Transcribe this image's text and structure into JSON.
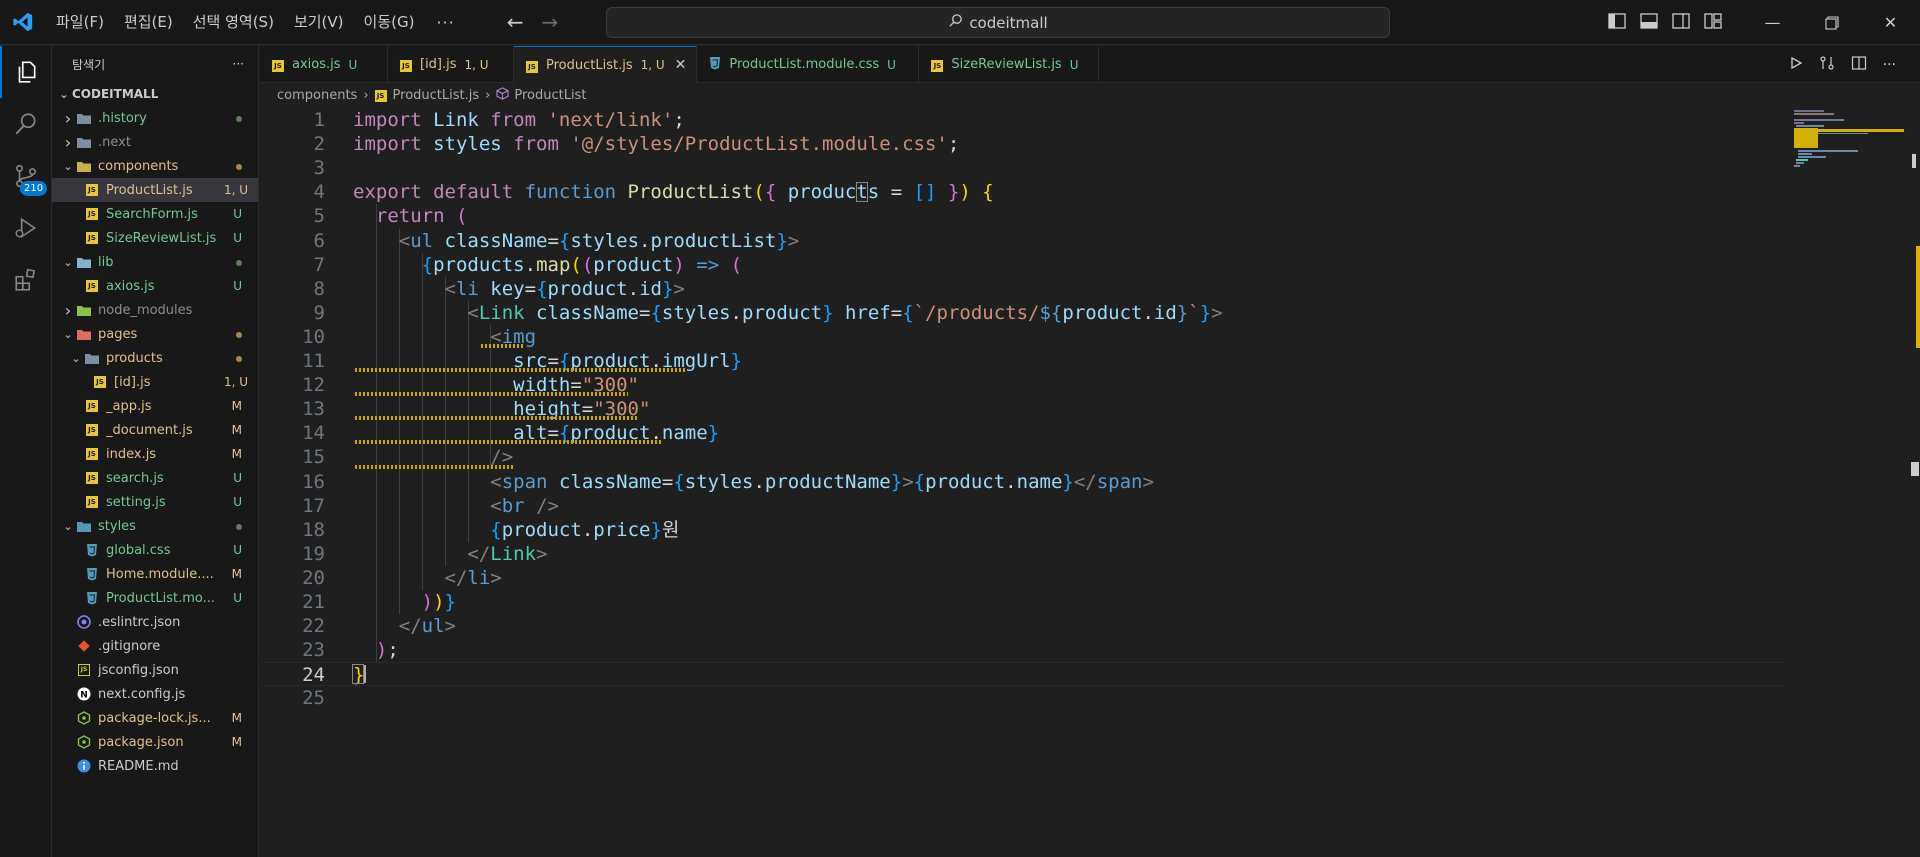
{
  "menu": [
    "파일(F)",
    "편집(E)",
    "선택 영역(S)",
    "보기(V)",
    "이동(G)"
  ],
  "menu_more": "···",
  "search": {
    "text": "codeitmall"
  },
  "activity": {
    "scm_badge": "210"
  },
  "explorer": {
    "title": "탐색기",
    "more": "···",
    "root": "CODEITMALL",
    "items": [
      {
        "name": ".history",
        "type": "folder",
        "depth": 0,
        "expanded": false,
        "status": "",
        "dot": "#5f7b59",
        "name_color": "#73c991",
        "icon_color": "#7f8fa3"
      },
      {
        "name": ".next",
        "type": "folder",
        "depth": 0,
        "expanded": false,
        "status": "",
        "dot": "",
        "name_color": "#8c8c8c",
        "icon_color": "#7f8fa3"
      },
      {
        "name": "components",
        "type": "folder",
        "depth": 0,
        "expanded": true,
        "status": "",
        "dot": "#a8884a",
        "name_color": "#e2c08d",
        "icon_color": "#c8b04a"
      },
      {
        "name": "ProductList.js",
        "type": "js",
        "depth": 1,
        "status": "1, U",
        "dot": "",
        "name_color": "#e2c08d",
        "selected": true
      },
      {
        "name": "SearchForm.js",
        "type": "js",
        "depth": 1,
        "status": "U",
        "dot": "",
        "name_color": "#73c991"
      },
      {
        "name": "SizeReviewList.js",
        "type": "js",
        "depth": 1,
        "status": "U",
        "dot": "",
        "name_color": "#73c991"
      },
      {
        "name": "lib",
        "type": "folder",
        "depth": 0,
        "expanded": true,
        "status": "",
        "dot": "#5f7b59",
        "name_color": "#73c991",
        "icon_color": "#7fb3d0"
      },
      {
        "name": "axios.js",
        "type": "js",
        "depth": 1,
        "status": "U",
        "dot": "",
        "name_color": "#73c991"
      },
      {
        "name": "node_modules",
        "type": "folder",
        "depth": 0,
        "expanded": false,
        "status": "",
        "dot": "",
        "name_color": "#8c8c8c",
        "icon_color": "#8bc34a"
      },
      {
        "name": "pages",
        "type": "folder",
        "depth": 0,
        "expanded": true,
        "status": "",
        "dot": "#a8884a",
        "name_color": "#e2c08d",
        "icon_color": "#e06c5a"
      },
      {
        "name": "products",
        "type": "folder",
        "depth": 1,
        "expanded": true,
        "status": "",
        "dot": "#a8884a",
        "name_color": "#e2c08d",
        "icon_color": "#7f8fa3"
      },
      {
        "name": "[id].js",
        "type": "js",
        "depth": 2,
        "status": "1, U",
        "dot": "",
        "name_color": "#e2c08d"
      },
      {
        "name": "_app.js",
        "type": "js",
        "depth": 1,
        "status": "M",
        "dot": "",
        "name_color": "#e2c08d"
      },
      {
        "name": "_document.js",
        "type": "js",
        "depth": 1,
        "status": "M",
        "dot": "",
        "name_color": "#e2c08d"
      },
      {
        "name": "index.js",
        "type": "js",
        "depth": 1,
        "status": "M",
        "dot": "",
        "name_color": "#e2c08d"
      },
      {
        "name": "search.js",
        "type": "js",
        "depth": 1,
        "status": "U",
        "dot": "",
        "name_color": "#73c991"
      },
      {
        "name": "setting.js",
        "type": "js",
        "depth": 1,
        "status": "U",
        "dot": "",
        "name_color": "#73c991"
      },
      {
        "name": "styles",
        "type": "folder",
        "depth": 0,
        "expanded": true,
        "status": "",
        "dot": "#5f7b59",
        "name_color": "#73c991",
        "icon_color": "#519aba"
      },
      {
        "name": "global.css",
        "type": "css",
        "depth": 1,
        "status": "U",
        "dot": "",
        "name_color": "#73c991"
      },
      {
        "name": "Home.module....",
        "type": "css",
        "depth": 1,
        "status": "M",
        "dot": "",
        "name_color": "#e2c08d"
      },
      {
        "name": "ProductList.mo...",
        "type": "css",
        "depth": 1,
        "status": "U",
        "dot": "",
        "name_color": "#73c991"
      },
      {
        "name": ".eslintrc.json",
        "type": "eslint",
        "depth": 0,
        "status": "",
        "dot": "",
        "name_color": "#cccccc"
      },
      {
        "name": ".gitignore",
        "type": "git",
        "depth": 0,
        "status": "",
        "dot": "",
        "name_color": "#cccccc"
      },
      {
        "name": "jsconfig.json",
        "type": "jsconfig",
        "depth": 0,
        "status": "",
        "dot": "",
        "name_color": "#cccccc"
      },
      {
        "name": "next.config.js",
        "type": "next",
        "depth": 0,
        "status": "",
        "dot": "",
        "name_color": "#cccccc"
      },
      {
        "name": "package-lock.js...",
        "type": "node",
        "depth": 0,
        "status": "M",
        "dot": "",
        "name_color": "#e2c08d"
      },
      {
        "name": "package.json",
        "type": "node",
        "depth": 0,
        "status": "M",
        "dot": "",
        "name_color": "#e2c08d"
      },
      {
        "name": "README.md",
        "type": "info",
        "depth": 0,
        "status": "",
        "dot": "",
        "name_color": "#cccccc"
      }
    ]
  },
  "tabs": [
    {
      "name": "axios.js",
      "status": "U",
      "type": "js",
      "active": false,
      "name_color": "#73c991"
    },
    {
      "name": "[id].js",
      "status": "1, U",
      "type": "js",
      "active": false,
      "name_color": "#e2c08d"
    },
    {
      "name": "ProductList.js",
      "status": "1, U",
      "type": "js",
      "active": true,
      "name_color": "#e2c08d"
    },
    {
      "name": "ProductList.module.css",
      "status": "U",
      "type": "css",
      "active": false,
      "name_color": "#73c991"
    },
    {
      "name": "SizeReviewList.js",
      "status": "U",
      "type": "js",
      "active": false,
      "name_color": "#73c991"
    }
  ],
  "breadcrumb": {
    "folder": "components",
    "file": "ProductList.js",
    "symbol": "ProductList"
  },
  "editor": {
    "current_line": 24,
    "lines": [
      [
        [
          "import ",
          "k-imp"
        ],
        [
          "Link ",
          "id"
        ],
        [
          "from ",
          "k-imp"
        ],
        [
          "'next/link'",
          "str"
        ],
        [
          ";",
          "plain"
        ]
      ],
      [
        [
          "import ",
          "k-imp"
        ],
        [
          "styles ",
          "id"
        ],
        [
          "from ",
          "k-imp"
        ],
        [
          "'@/styles/ProductList.module.css'",
          "str"
        ],
        [
          ";",
          "plain"
        ]
      ],
      [],
      [
        [
          "export ",
          "k-imp"
        ],
        [
          "default ",
          "k-imp"
        ],
        [
          "function ",
          "k-dec"
        ],
        [
          "ProductList",
          "fn"
        ],
        [
          "(",
          "b1"
        ],
        [
          "{",
          "b2"
        ],
        [
          " products ",
          "id"
        ],
        [
          "= ",
          "plain"
        ],
        [
          "[]",
          "b3"
        ],
        [
          " ",
          "plain"
        ],
        [
          "}",
          "b2"
        ],
        [
          ")",
          "b1"
        ],
        [
          " ",
          "plain"
        ],
        [
          "{",
          "b1"
        ]
      ],
      [
        [
          "  return ",
          "k-imp"
        ],
        [
          "(",
          "b2"
        ]
      ],
      [
        [
          "    ",
          "plain"
        ],
        [
          "<",
          "pun"
        ],
        [
          "ul ",
          "tag"
        ],
        [
          "className",
          "id"
        ],
        [
          "=",
          "plain"
        ],
        [
          "{",
          "b3"
        ],
        [
          "styles",
          "id"
        ],
        [
          ".",
          "plain"
        ],
        [
          "productList",
          "id"
        ],
        [
          "}",
          "b3"
        ],
        [
          ">",
          "pun"
        ]
      ],
      [
        [
          "      ",
          "plain"
        ],
        [
          "{",
          "b3"
        ],
        [
          "products",
          "id"
        ],
        [
          ".",
          "plain"
        ],
        [
          "map",
          "fn"
        ],
        [
          "(",
          "b1"
        ],
        [
          "(",
          "b2"
        ],
        [
          "product",
          "id"
        ],
        [
          ")",
          "b2"
        ],
        [
          " => ",
          "k-dec"
        ],
        [
          "(",
          "b2"
        ]
      ],
      [
        [
          "        ",
          "plain"
        ],
        [
          "<",
          "pun"
        ],
        [
          "li ",
          "tag"
        ],
        [
          "key",
          "id"
        ],
        [
          "=",
          "plain"
        ],
        [
          "{",
          "b3"
        ],
        [
          "product",
          "id"
        ],
        [
          ".",
          "plain"
        ],
        [
          "id",
          "id"
        ],
        [
          "}",
          "b3"
        ],
        [
          ">",
          "pun"
        ]
      ],
      [
        [
          "          ",
          "plain"
        ],
        [
          "<",
          "pun"
        ],
        [
          "Link ",
          "comp"
        ],
        [
          "className",
          "id"
        ],
        [
          "=",
          "plain"
        ],
        [
          "{",
          "b3"
        ],
        [
          "styles",
          "id"
        ],
        [
          ".",
          "plain"
        ],
        [
          "product",
          "id"
        ],
        [
          "}",
          "b3"
        ],
        [
          " href",
          "id"
        ],
        [
          "=",
          "plain"
        ],
        [
          "{",
          "b3"
        ],
        [
          "`/products/",
          "str"
        ],
        [
          "${",
          "k-dec"
        ],
        [
          "product",
          "id"
        ],
        [
          ".",
          "plain"
        ],
        [
          "id",
          "id"
        ],
        [
          "}",
          "k-dec"
        ],
        [
          "`",
          "str"
        ],
        [
          "}",
          "b3"
        ],
        [
          ">",
          "pun"
        ]
      ],
      [
        [
          "            ",
          "plain"
        ],
        [
          "<",
          "pun"
        ],
        [
          "img",
          "tag"
        ]
      ],
      [
        [
          "              src",
          "id"
        ],
        [
          "=",
          "plain"
        ],
        [
          "{",
          "b3"
        ],
        [
          "product",
          "id"
        ],
        [
          ".",
          "plain"
        ],
        [
          "imgUrl",
          "id"
        ],
        [
          "}",
          "b3"
        ]
      ],
      [
        [
          "              width",
          "id"
        ],
        [
          "=",
          "plain"
        ],
        [
          "\"300\"",
          "str"
        ]
      ],
      [
        [
          "              height",
          "id"
        ],
        [
          "=",
          "plain"
        ],
        [
          "\"300\"",
          "str"
        ]
      ],
      [
        [
          "              alt",
          "id"
        ],
        [
          "=",
          "plain"
        ],
        [
          "{",
          "b3"
        ],
        [
          "product",
          "id"
        ],
        [
          ".",
          "plain"
        ],
        [
          "name",
          "id"
        ],
        [
          "}",
          "b3"
        ]
      ],
      [
        [
          "            ",
          "plain"
        ],
        [
          "/>",
          "pun"
        ]
      ],
      [
        [
          "            ",
          "plain"
        ],
        [
          "<",
          "pun"
        ],
        [
          "span ",
          "tag"
        ],
        [
          "className",
          "id"
        ],
        [
          "=",
          "plain"
        ],
        [
          "{",
          "b3"
        ],
        [
          "styles",
          "id"
        ],
        [
          ".",
          "plain"
        ],
        [
          "productName",
          "id"
        ],
        [
          "}",
          "b3"
        ],
        [
          ">",
          "pun"
        ],
        [
          "{",
          "b3"
        ],
        [
          "product",
          "id"
        ],
        [
          ".",
          "plain"
        ],
        [
          "name",
          "id"
        ],
        [
          "}",
          "b3"
        ],
        [
          "</",
          "pun"
        ],
        [
          "span",
          "tag"
        ],
        [
          ">",
          "pun"
        ]
      ],
      [
        [
          "            ",
          "plain"
        ],
        [
          "<",
          "pun"
        ],
        [
          "br ",
          "tag"
        ],
        [
          "/>",
          "pun"
        ]
      ],
      [
        [
          "            ",
          "plain"
        ],
        [
          "{",
          "b3"
        ],
        [
          "product",
          "id"
        ],
        [
          ".",
          "plain"
        ],
        [
          "price",
          "id"
        ],
        [
          "}",
          "b3"
        ],
        [
          "원",
          "plain"
        ]
      ],
      [
        [
          "          ",
          "plain"
        ],
        [
          "</",
          "pun"
        ],
        [
          "Link",
          "comp"
        ],
        [
          ">",
          "pun"
        ]
      ],
      [
        [
          "        ",
          "plain"
        ],
        [
          "</",
          "pun"
        ],
        [
          "li",
          "tag"
        ],
        [
          ">",
          "pun"
        ]
      ],
      [
        [
          "      ",
          "plain"
        ],
        [
          ")",
          "b2"
        ],
        [
          ")",
          "b1"
        ],
        [
          "}",
          "b3"
        ]
      ],
      [
        [
          "    ",
          "plain"
        ],
        [
          "</",
          "pun"
        ],
        [
          "ul",
          "tag"
        ],
        [
          ">",
          "pun"
        ]
      ],
      [
        [
          "  ",
          "plain"
        ],
        [
          ")",
          "b2"
        ],
        [
          ";",
          "plain"
        ]
      ],
      [
        [
          "}",
          "b1"
        ]
      ],
      []
    ]
  },
  "colors": {
    "accent": "#0078d4",
    "background": "#1f1f1f",
    "sidebar": "#181818",
    "warning_squiggle": "#cca700"
  }
}
